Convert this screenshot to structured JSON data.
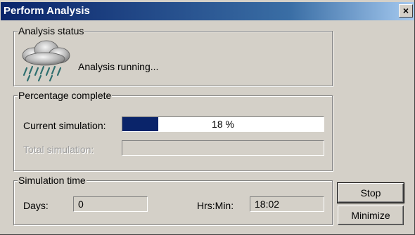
{
  "window": {
    "title": "Perform Analysis",
    "close_label": "×"
  },
  "status": {
    "legend": "Analysis status",
    "text": "Analysis running...",
    "icon": "rain-cloud-icon"
  },
  "percentage": {
    "legend": "Percentage complete",
    "current_label": "Current simulation:",
    "current_value_text": "18 %",
    "current_fraction": 0.18,
    "total_label": "Total simulation:",
    "total_fraction": 0
  },
  "time": {
    "legend": "Simulation time",
    "days_label": "Days:",
    "days_value": "0",
    "hrsmin_label": "Hrs:Min:",
    "hrsmin_value": "18:02"
  },
  "buttons": {
    "stop": "Stop",
    "minimize": "Minimize"
  },
  "colors": {
    "progress_fill": "#0a246a",
    "dialog_face": "#d4d0c8"
  }
}
